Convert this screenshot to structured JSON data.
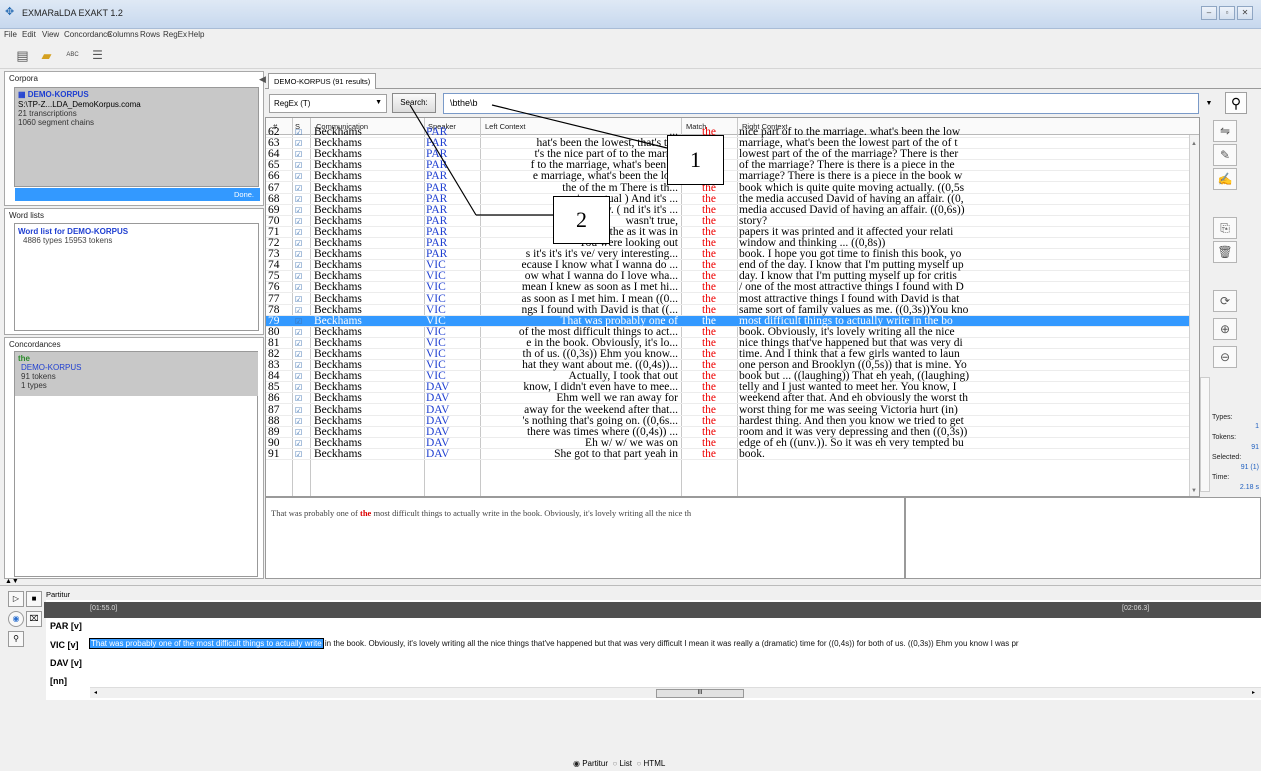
{
  "window": {
    "title": "EXMARaLDA EXAKT 1.2"
  },
  "menu": [
    "File",
    "Edit",
    "View",
    "Concordance",
    "Columns",
    "Rows",
    "RegEx",
    "Help"
  ],
  "toolbar": {
    "abc": "ABC"
  },
  "corpora": {
    "label": "Corpora",
    "name": "DEMO-KORPUS",
    "path": "S:\\TP-Z...LDA_DemoKorpus.coma",
    "transcriptions": "21 transcriptions",
    "segment_chains": "1060 segment chains",
    "status": "Done."
  },
  "wordlists": {
    "label": "Word lists",
    "title": "Word list for DEMO-KORPUS",
    "stats": "4886 types  15953 tokens"
  },
  "concordances": {
    "label": "Concordances",
    "query": "the",
    "corpus": "DEMO-KORPUS",
    "tokens": "91 tokens",
    "types": "1 types"
  },
  "tab": {
    "label": "DEMO-KORPUS (91 results)"
  },
  "search": {
    "mode": "RegEx (T)",
    "button": "Search:",
    "regex": "\\bthe\\b"
  },
  "columns": [
    "#",
    "S",
    "Communication",
    "Speaker",
    "Left Context",
    "Match",
    "Right Context"
  ],
  "rows": [
    {
      "n": "62",
      "c": "Beckhams",
      "s": "PAR",
      "l": "...",
      "m": "the",
      "r": "nice part of to the marriage. what's been the low"
    },
    {
      "n": "63",
      "c": "Beckhams",
      "s": "PAR",
      "l": "hat's been the lowest, that's the",
      "m": "the",
      "r": "marriage, what's been the lowest part of the of t"
    },
    {
      "n": "64",
      "c": "Beckhams",
      "s": "PAR",
      "l": "t's the nice part of to the marria",
      "m": "the",
      "r": "lowest part of the of the marriage? There is ther"
    },
    {
      "n": "65",
      "c": "Beckhams",
      "s": "PAR",
      "l": "f to the marriage, what's been th",
      "m": "the",
      "r": "of the marriage? There is there is a piece in the"
    },
    {
      "n": "66",
      "c": "Beckhams",
      "s": "PAR",
      "l": "e marriage, what's been the low",
      "m": "the",
      "r": "marriage? There is there is a piece in the book w"
    },
    {
      "n": "67",
      "c": "Beckhams",
      "s": "PAR",
      "l": "the of the m          There is th...",
      "m": "the",
      "r": "book which is quite quite moving actually. ((0,5s"
    },
    {
      "n": "68",
      "c": "Beckhams",
      "s": "PAR",
      "l": "oving actual          ) And it's ...",
      "m": "the",
      "r": "the media accused David of having an affair. ((0,"
    },
    {
      "n": "69",
      "c": "Beckhams",
      "s": "PAR",
      "l": "g actually. (          nd it's it's ...",
      "m": "the",
      "r": "media accused David of having an affair. ((0,6s))"
    },
    {
      "n": "70",
      "c": "Beckhams",
      "s": "PAR",
      "l": "                    wasn't true,",
      "m": "the",
      "r": "story?"
    },
    {
      "n": "71",
      "c": "Beckhams",
      "s": "PAR",
      "l": "But nonethe          as it was in",
      "m": "the",
      "r": "papers it was printed and it affected your relati"
    },
    {
      "n": "72",
      "c": "Beckhams",
      "s": "PAR",
      "l": "You were looking out",
      "m": "the",
      "r": "window and thinking ... ((0,8s))"
    },
    {
      "n": "73",
      "c": "Beckhams",
      "s": "PAR",
      "l": "s it's it's it's ve/ very interesting...",
      "m": "the",
      "r": "book. I hope you got time to finish this book, yo"
    },
    {
      "n": "74",
      "c": "Beckhams",
      "s": "VIC",
      "l": "ecause I know what I wanna do ...",
      "m": "the",
      "r": "end of the day. I know that I'm putting myself up"
    },
    {
      "n": "75",
      "c": "Beckhams",
      "s": "VIC",
      "l": "ow what I wanna do I love wha...",
      "m": "the",
      "r": "day. I know that I'm putting myself up for critis"
    },
    {
      "n": "76",
      "c": "Beckhams",
      "s": "VIC",
      "l": "mean I knew as soon as I met hi...",
      "m": "the",
      "r": "/ one of the most attractive things I found with D"
    },
    {
      "n": "77",
      "c": "Beckhams",
      "s": "VIC",
      "l": "as soon as I met him. I mean ((0...",
      "m": "the",
      "r": "most attractive things I found with David is that"
    },
    {
      "n": "78",
      "c": "Beckhams",
      "s": "VIC",
      "l": "ngs I found with David is that ((...",
      "m": "the",
      "r": "same sort of family values as me. ((0,3s))You kno"
    },
    {
      "n": "79",
      "c": "Beckhams",
      "s": "VIC",
      "l": "That was probably one of",
      "m": "the",
      "r": "most difficult things to actually write in the bo",
      "sel": true
    },
    {
      "n": "80",
      "c": "Beckhams",
      "s": "VIC",
      "l": "of the most difficult things to act...",
      "m": "the",
      "r": "book. Obviously, it's lovely writing all the nice"
    },
    {
      "n": "81",
      "c": "Beckhams",
      "s": "VIC",
      "l": "e in the book. Obviously, it's lo...",
      "m": "the",
      "r": "nice things that've happened but that was very di"
    },
    {
      "n": "82",
      "c": "Beckhams",
      "s": "VIC",
      "l": "th of us. ((0,3s)) Ehm you know...",
      "m": "the",
      "r": "time. And I think that a few girls wanted to laun"
    },
    {
      "n": "83",
      "c": "Beckhams",
      "s": "VIC",
      "l": "hat they want about me. ((0,4s))...",
      "m": "the",
      "r": "one person and Brooklyn ((0,5s)) that is mine. Yo"
    },
    {
      "n": "84",
      "c": "Beckhams",
      "s": "VIC",
      "l": "Actually, I took that out",
      "m": "the",
      "r": "book but ... ((laughing)) That eh yeah, ((laughing)"
    },
    {
      "n": "85",
      "c": "Beckhams",
      "s": "DAV",
      "l": "know, I didn't even have to mee...",
      "m": "the",
      "r": "telly and I just wanted to meet her. You know, I"
    },
    {
      "n": "86",
      "c": "Beckhams",
      "s": "DAV",
      "l": "Ehm well we ran away for",
      "m": "the",
      "r": "weekend after that. And eh obviously the worst th"
    },
    {
      "n": "87",
      "c": "Beckhams",
      "s": "DAV",
      "l": "away for the weekend after that...",
      "m": "the",
      "r": "worst thing for me was seeing Victoria hurt (in)"
    },
    {
      "n": "88",
      "c": "Beckhams",
      "s": "DAV",
      "l": "'s nothing that's going on. ((0,6s...",
      "m": "the",
      "r": "hardest thing. And then you know we tried to get"
    },
    {
      "n": "89",
      "c": "Beckhams",
      "s": "DAV",
      "l": "there was times where ((0,4s)) ...",
      "m": "the",
      "r": "room and it was very depressing and then ((0,3s))"
    },
    {
      "n": "90",
      "c": "Beckhams",
      "s": "DAV",
      "l": "Eh w/ w/ we was on",
      "m": "the",
      "r": "edge of eh ((unv.)). So it was eh very tempted bu"
    },
    {
      "n": "91",
      "c": "Beckhams",
      "s": "DAV",
      "l": "She got to that part yeah in",
      "m": "the",
      "r": "book."
    }
  ],
  "callouts": {
    "one": "1",
    "two": "2"
  },
  "preview": {
    "before": "That was probably one of ",
    "match": "the",
    "after": " most difficult things to actually write in the book. Obviously, it's lovely writing all the nice th"
  },
  "stats": {
    "types_label": "Types:",
    "types": "1",
    "tokens_label": "Tokens:",
    "tokens": "91",
    "selected_label": "Selected:",
    "selected": "91 (1)",
    "time_label": "Time:",
    "time": "2.18 s"
  },
  "partitur": {
    "label": "Partitur",
    "t_start": "[01:55.0]",
    "t_end": "[02:06.3]",
    "tiers": [
      "PAR [v]",
      "VIC [v]",
      "DAV [v]",
      "[nn]"
    ],
    "vic_highlight": "That was probably one of the most difficult things to actually write",
    "vic_rest": " in the book.  Obviously, it's lovely writing all the nice things that've happened  but that was very difficult I mean it was really a (dramatic) time for ((0,4s))  for both of us.  ((0,3s)) Ehm you know I was pr",
    "scroll_thumb": "III"
  },
  "views": {
    "partitur": "Partitur",
    "list": "List",
    "html": "HTML"
  },
  "colors": {
    "selection": "#3399ff",
    "match": "#e00000",
    "speaker": "#1f3fd1"
  }
}
